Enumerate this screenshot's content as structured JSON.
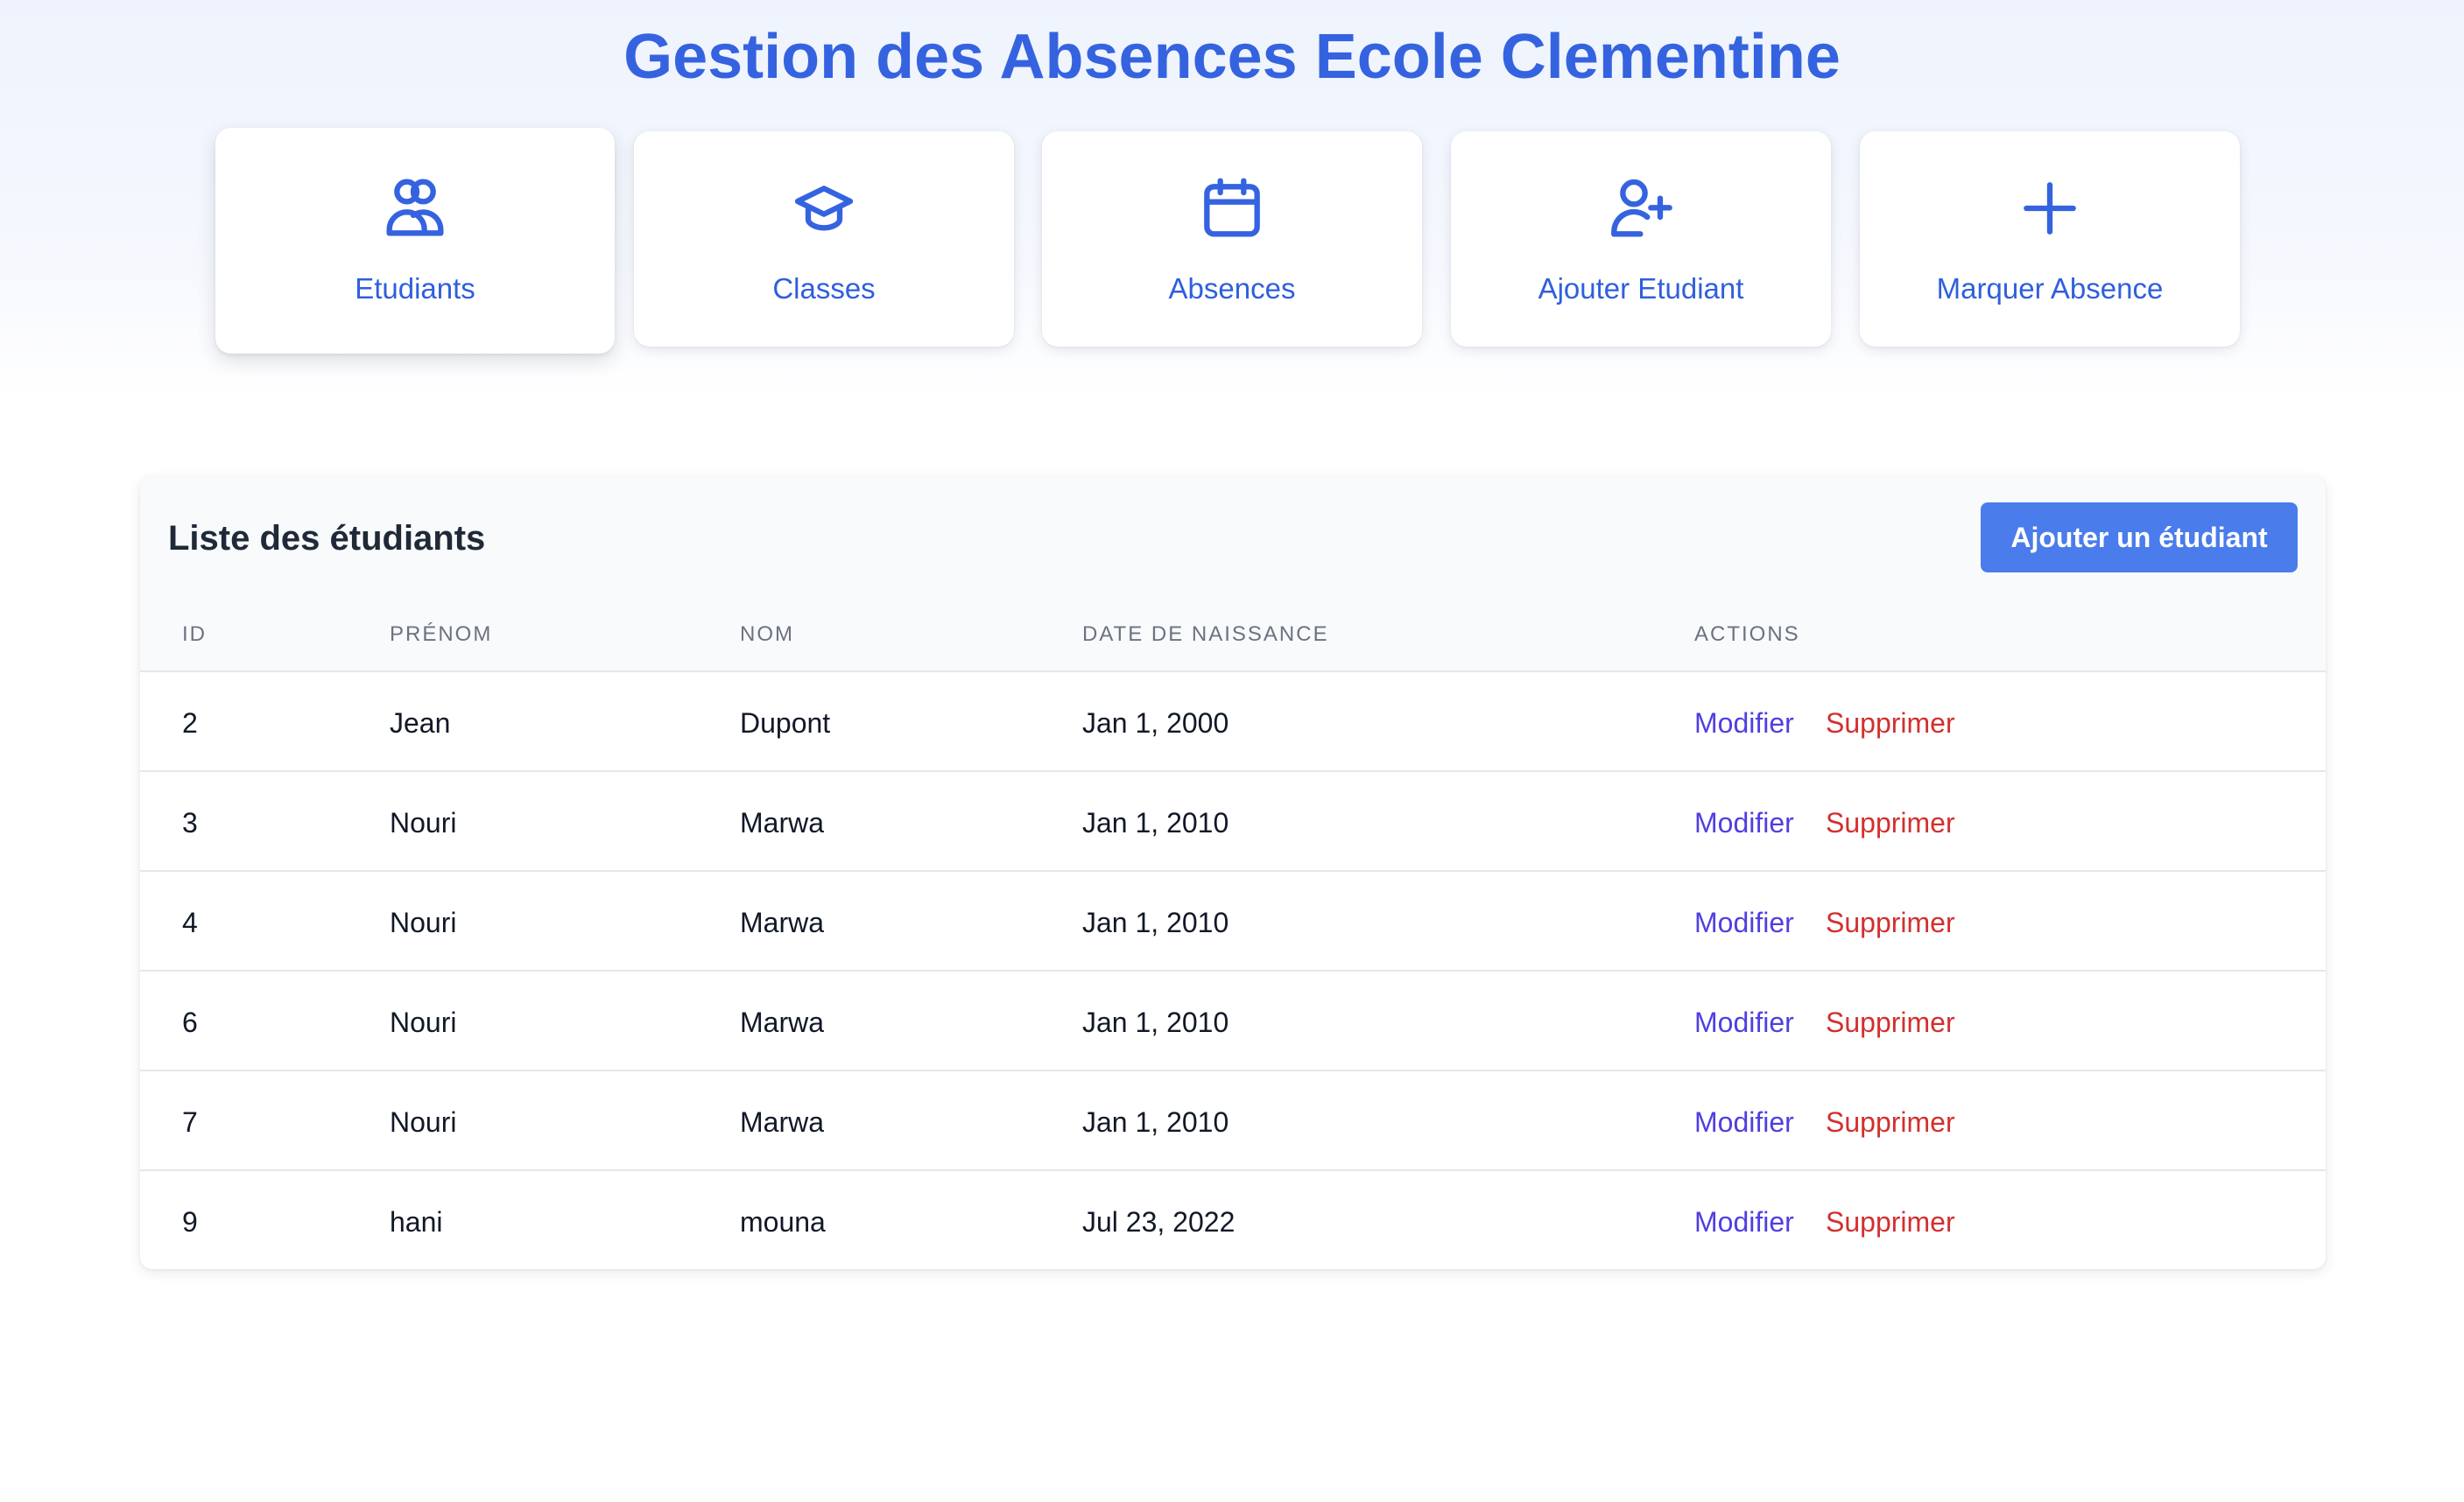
{
  "header": {
    "title": "Gestion des Absences Ecole Clementine"
  },
  "nav": {
    "items": [
      {
        "label": "Etudiants",
        "icon": "users-icon",
        "active": true
      },
      {
        "label": "Classes",
        "icon": "graduation-cap-icon",
        "active": false
      },
      {
        "label": "Absences",
        "icon": "calendar-icon",
        "active": false
      },
      {
        "label": "Ajouter Etudiant",
        "icon": "user-plus-icon",
        "active": false
      },
      {
        "label": "Marquer Absence",
        "icon": "plus-icon",
        "active": false
      }
    ]
  },
  "students": {
    "title": "Liste des étudiants",
    "add_button_label": "Ajouter un étudiant",
    "columns": [
      "ID",
      "Prénom",
      "Nom",
      "Date de naissance",
      "Actions"
    ],
    "rows": [
      {
        "id": "2",
        "prenom": "Jean",
        "nom": "Dupont",
        "date": "Jan 1, 2000",
        "edit": "Modifier",
        "delete": "Supprimer"
      },
      {
        "id": "3",
        "prenom": "Nouri",
        "nom": "Marwa",
        "date": "Jan 1, 2010",
        "edit": "Modifier",
        "delete": "Supprimer"
      },
      {
        "id": "4",
        "prenom": "Nouri",
        "nom": "Marwa",
        "date": "Jan 1, 2010",
        "edit": "Modifier",
        "delete": "Supprimer"
      },
      {
        "id": "6",
        "prenom": "Nouri",
        "nom": "Marwa",
        "date": "Jan 1, 2010",
        "edit": "Modifier",
        "delete": "Supprimer"
      },
      {
        "id": "7",
        "prenom": "Nouri",
        "nom": "Marwa",
        "date": "Jan 1, 2010",
        "edit": "Modifier",
        "delete": "Supprimer"
      },
      {
        "id": "9",
        "prenom": "hani",
        "nom": "mouna",
        "date": "Jul 23, 2022",
        "edit": "Modifier",
        "delete": "Supprimer"
      }
    ]
  },
  "colors": {
    "accent": "#3563e0",
    "button": "#4a7cec",
    "edit_link": "#4f3fe0",
    "delete_link": "#d32f2f"
  }
}
